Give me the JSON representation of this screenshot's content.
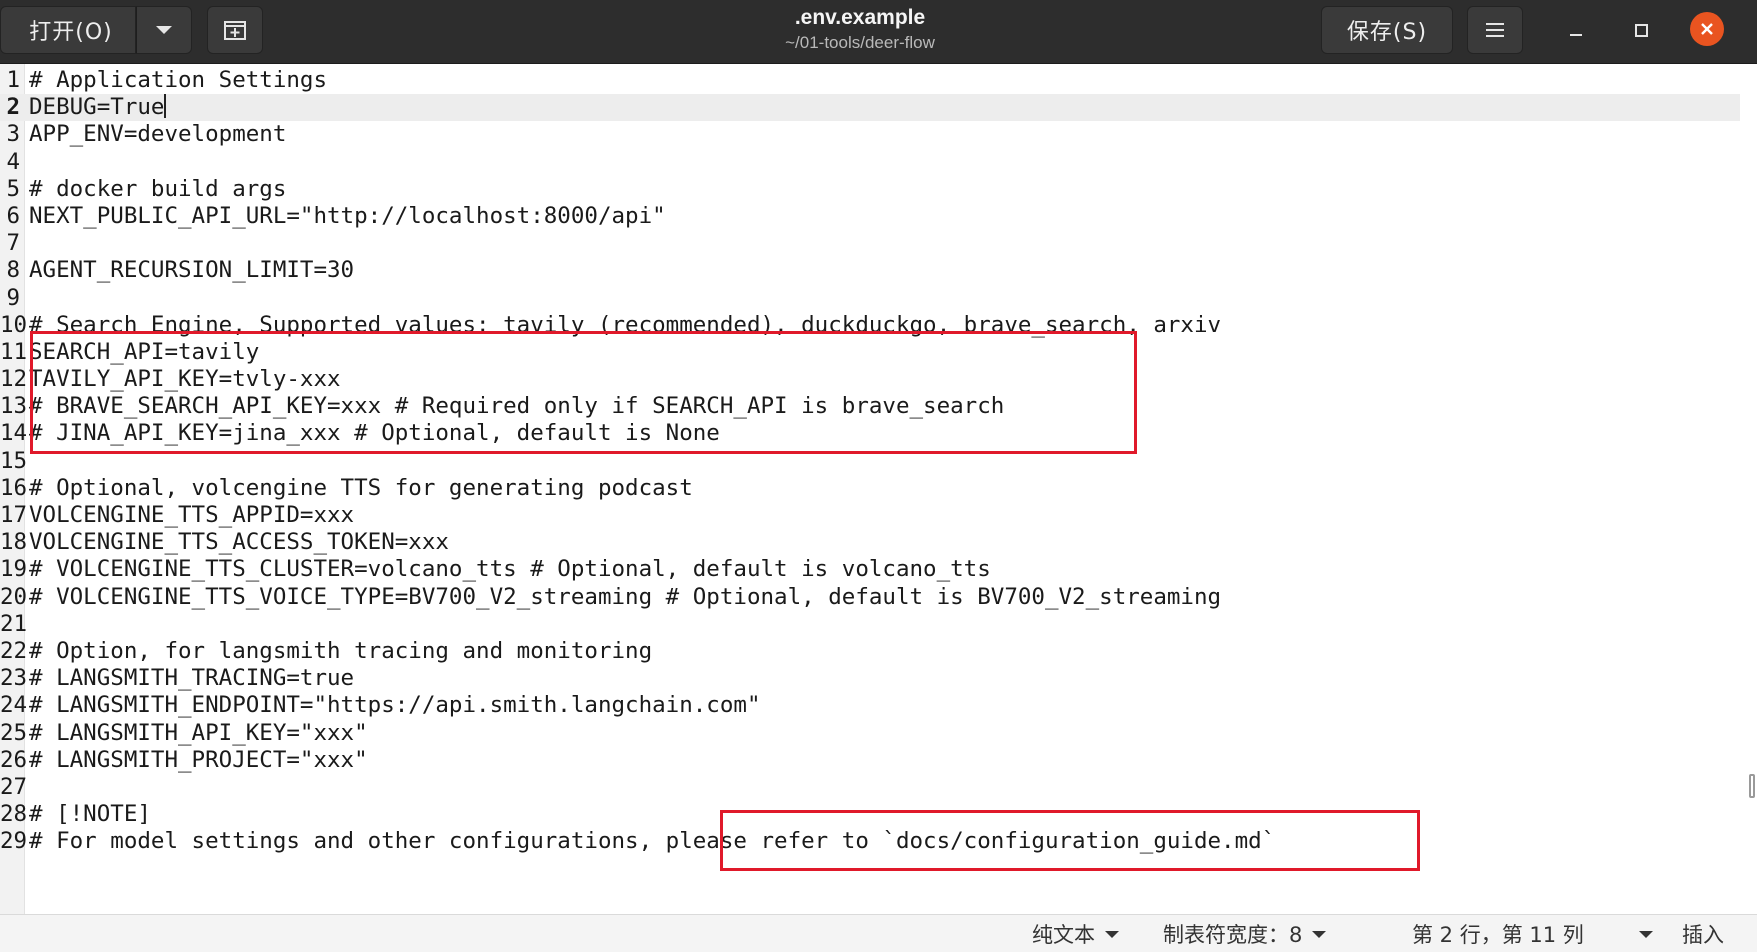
{
  "header": {
    "open_label": "打开(O)",
    "title": ".env.example",
    "subtitle": "~/01-tools/deer-flow",
    "save_label": "保存(S)",
    "icons": [
      "chevron-down-icon",
      "new-tab-icon",
      "hamburger-menu-icon",
      "minimize-icon",
      "maximize-icon",
      "close-icon"
    ],
    "close_color": "#e95420"
  },
  "editor": {
    "current_line": 2,
    "lines": [
      "# Application Settings",
      "DEBUG=True",
      "APP_ENV=development",
      "",
      "# docker build args",
      "NEXT_PUBLIC_API_URL=\"http://localhost:8000/api\"",
      "",
      "AGENT_RECURSION_LIMIT=30",
      "",
      "# Search Engine, Supported values: tavily (recommended), duckduckgo, brave_search, arxiv",
      "SEARCH_API=tavily",
      "TAVILY_API_KEY=tvly-xxx",
      "# BRAVE_SEARCH_API_KEY=xxx # Required only if SEARCH_API is brave_search",
      "# JINA_API_KEY=jina_xxx # Optional, default is None",
      "",
      "# Optional, volcengine TTS for generating podcast",
      "VOLCENGINE_TTS_APPID=xxx",
      "VOLCENGINE_TTS_ACCESS_TOKEN=xxx",
      "# VOLCENGINE_TTS_CLUSTER=volcano_tts # Optional, default is volcano_tts",
      "# VOLCENGINE_TTS_VOICE_TYPE=BV700_V2_streaming # Optional, default is BV700_V2_streaming",
      "",
      "# Option, for langsmith tracing and monitoring",
      "# LANGSMITH_TRACING=true",
      "# LANGSMITH_ENDPOINT=\"https://api.smith.langchain.com\"",
      "# LANGSMITH_API_KEY=\"xxx\"",
      "# LANGSMITH_PROJECT=\"xxx\"",
      "",
      "# [!NOTE]",
      "# For model settings and other configurations, please refer to `docs/configuration_guide.md`"
    ],
    "line_numbers": [
      "1",
      "2",
      "3",
      "4",
      "5",
      "6",
      "7",
      "8",
      "9",
      "10",
      "11",
      "12",
      "13",
      "14",
      "15",
      "16",
      "17",
      "18",
      "19",
      "20",
      "21",
      "22",
      "23",
      "24",
      "25",
      "26",
      "27",
      "28",
      "29"
    ],
    "highlight_color": "#e0192a"
  },
  "statusbar": {
    "language": "纯文本",
    "tab_width": "制表符宽度：8",
    "position": "第 2 行，第 11 列",
    "mode": "插入"
  }
}
